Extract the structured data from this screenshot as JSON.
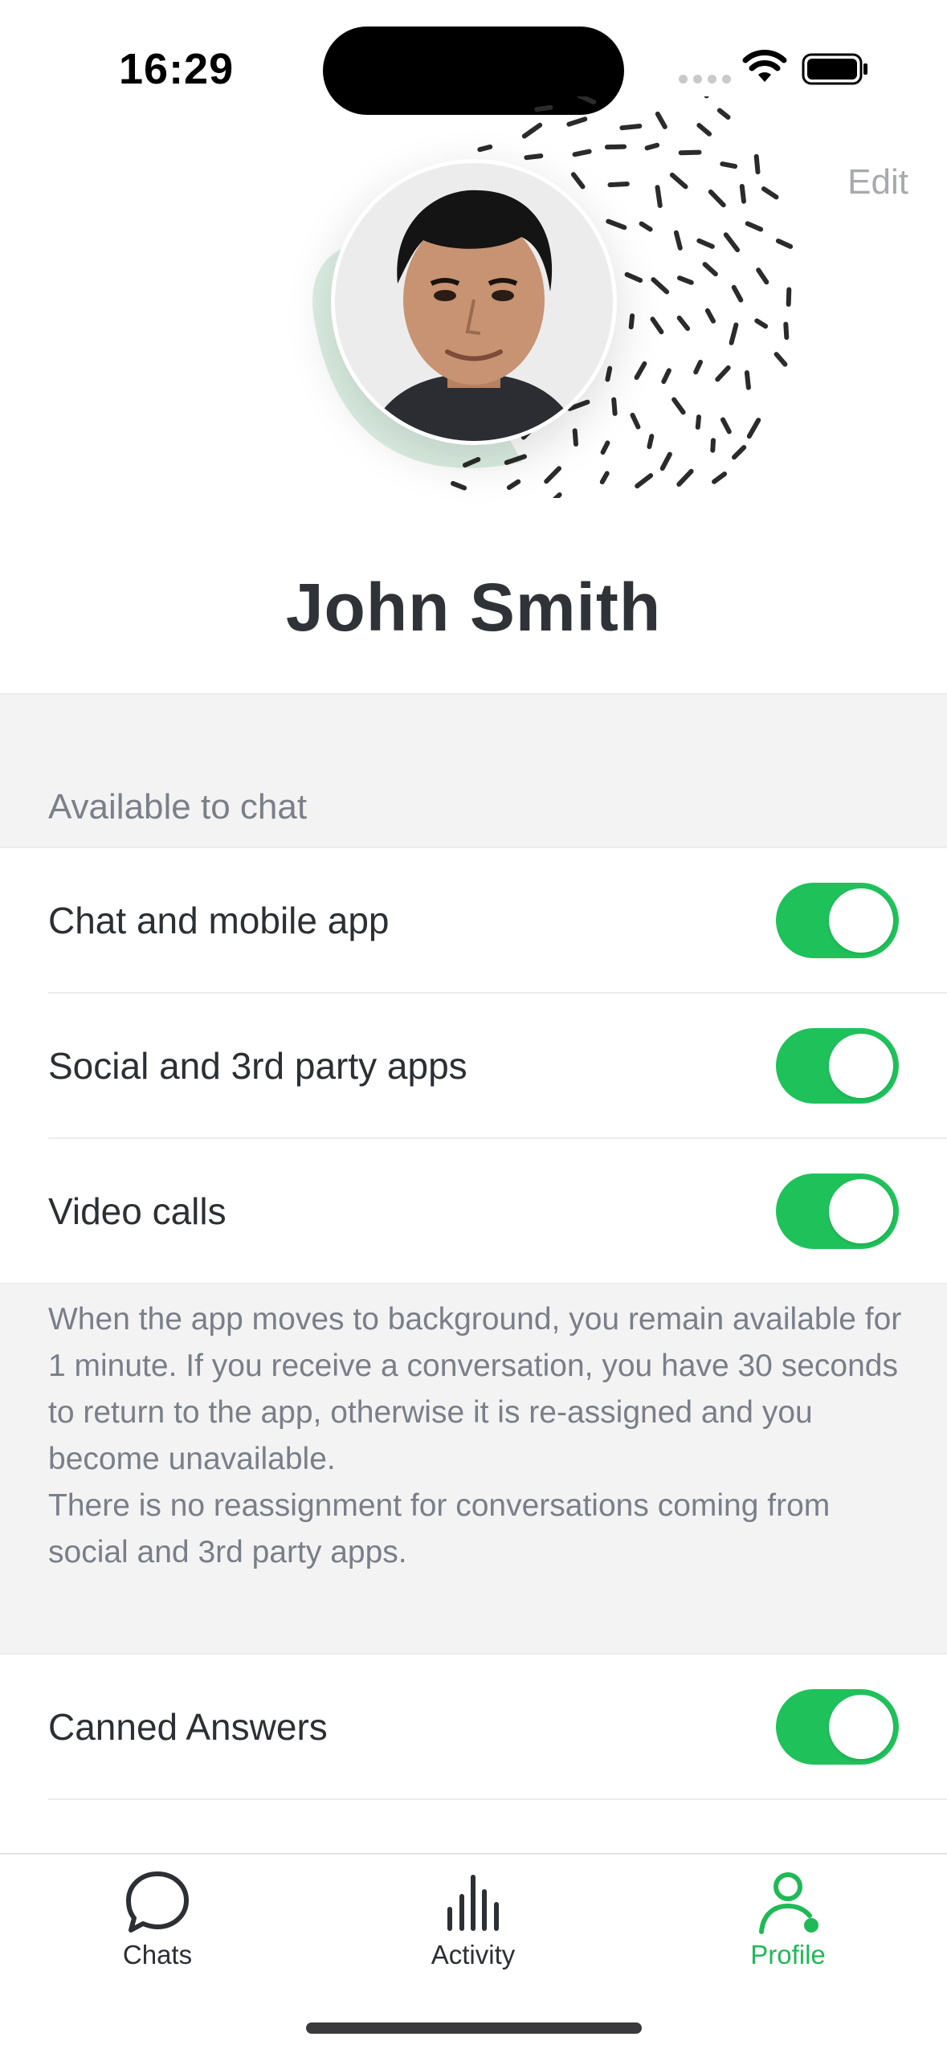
{
  "status_bar": {
    "time": "16:29",
    "icons": [
      "cellular-signal-icon",
      "wifi-icon",
      "battery-icon"
    ]
  },
  "header": {
    "edit_label": "Edit",
    "user_name": "John Smith",
    "avatar": "profile-photo"
  },
  "availability": {
    "section_title": "Available to chat",
    "items": [
      {
        "label": "Chat and mobile app",
        "enabled": true
      },
      {
        "label": "Social and 3rd party apps",
        "enabled": true
      },
      {
        "label": "Video calls",
        "enabled": true
      }
    ],
    "info_paragraphs": [
      "When the app moves to background, you remain available for 1 minute. If you receive a conversation, you have 30 seconds to return to the app, otherwise it is re-assigned and you become unavailable.",
      "There is no reassignment for conversations coming from social and 3rd party apps."
    ]
  },
  "settings": {
    "canned_answers_label": "Canned Answers",
    "canned_answers_enabled": true
  },
  "tab_bar": {
    "tabs": [
      {
        "label": "Chats",
        "icon": "chat-bubble-icon",
        "active": false
      },
      {
        "label": "Activity",
        "icon": "bar-chart-icon",
        "active": false
      },
      {
        "label": "Profile",
        "icon": "person-icon",
        "active": true
      }
    ]
  },
  "colors": {
    "accent_green": "#1fc25a",
    "tab_active": "#1fb957",
    "section_gray": "#f3f3f4",
    "muted_text": "#7a7e88"
  }
}
